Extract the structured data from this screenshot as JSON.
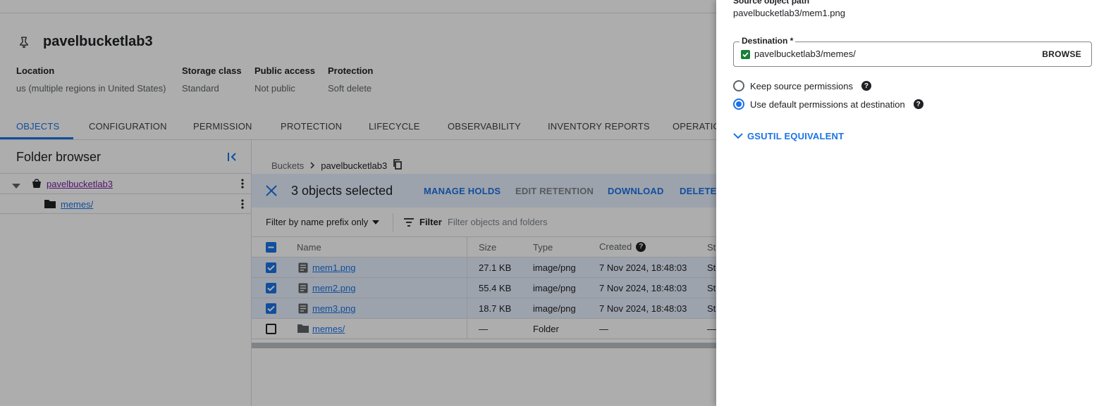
{
  "bucket": {
    "name": "pavelbucketlab3",
    "meta": [
      {
        "key": "Location",
        "value": "us (multiple regions in United States)"
      },
      {
        "key": "Storage class",
        "value": "Standard"
      },
      {
        "key": "Public access",
        "value": "Not public"
      },
      {
        "key": "Protection",
        "value": "Soft delete"
      }
    ]
  },
  "tabs": [
    "OBJECTS",
    "CONFIGURATION",
    "PERMISSION",
    "PROTECTION",
    "LIFECYCLE",
    "OBSERVABILITY",
    "INVENTORY REPORTS",
    "OPERATIO"
  ],
  "folder_browser": {
    "title": "Folder browser",
    "items": [
      {
        "label": "pavelbucketlab3"
      },
      {
        "label": "memes/"
      }
    ]
  },
  "breadcrumb": {
    "root": "Buckets",
    "current": "pavelbucketlab3"
  },
  "selection": {
    "count_text": "3 objects selected",
    "actions": [
      "MANAGE HOLDS",
      "EDIT RETENTION",
      "DOWNLOAD",
      "DELETE"
    ]
  },
  "filter": {
    "prefix_label": "Filter by name prefix only",
    "filter_label": "Filter",
    "placeholder": "Filter objects and folders"
  },
  "table": {
    "headers": {
      "name": "Name",
      "size": "Size",
      "type": "Type",
      "created": "Created",
      "storage": "St"
    },
    "rows": [
      {
        "name": "mem1.png",
        "size": "27.1 KB",
        "type": "image/png",
        "created": "7 Nov 2024, 18:48:03",
        "storage": "St",
        "checked": true
      },
      {
        "name": "mem2.png",
        "size": "55.4 KB",
        "type": "image/png",
        "created": "7 Nov 2024, 18:48:03",
        "storage": "St",
        "checked": true
      },
      {
        "name": "mem3.png",
        "size": "18.7 KB",
        "type": "image/png",
        "created": "7 Nov 2024, 18:48:03",
        "storage": "St",
        "checked": true
      },
      {
        "name": "memes/",
        "size": "—",
        "type": "Folder",
        "created": "—",
        "storage": "—",
        "checked": false
      }
    ]
  },
  "panel": {
    "source_label": "Source object path",
    "source_path": "pavelbucketlab3/mem1.png",
    "destination_label": "Destination *",
    "destination_value": "pavelbucketlab3/memes/",
    "browse_label": "BROWSE",
    "keep_permissions": "Keep source permissions",
    "default_permissions": "Use default permissions at destination",
    "gsutil": "GSUTIL EQUIVALENT",
    "selected_permission": "default"
  },
  "colors": {
    "accent": "#1a73e8",
    "selected_row": "#e8f0fe",
    "valid": "#188038"
  }
}
